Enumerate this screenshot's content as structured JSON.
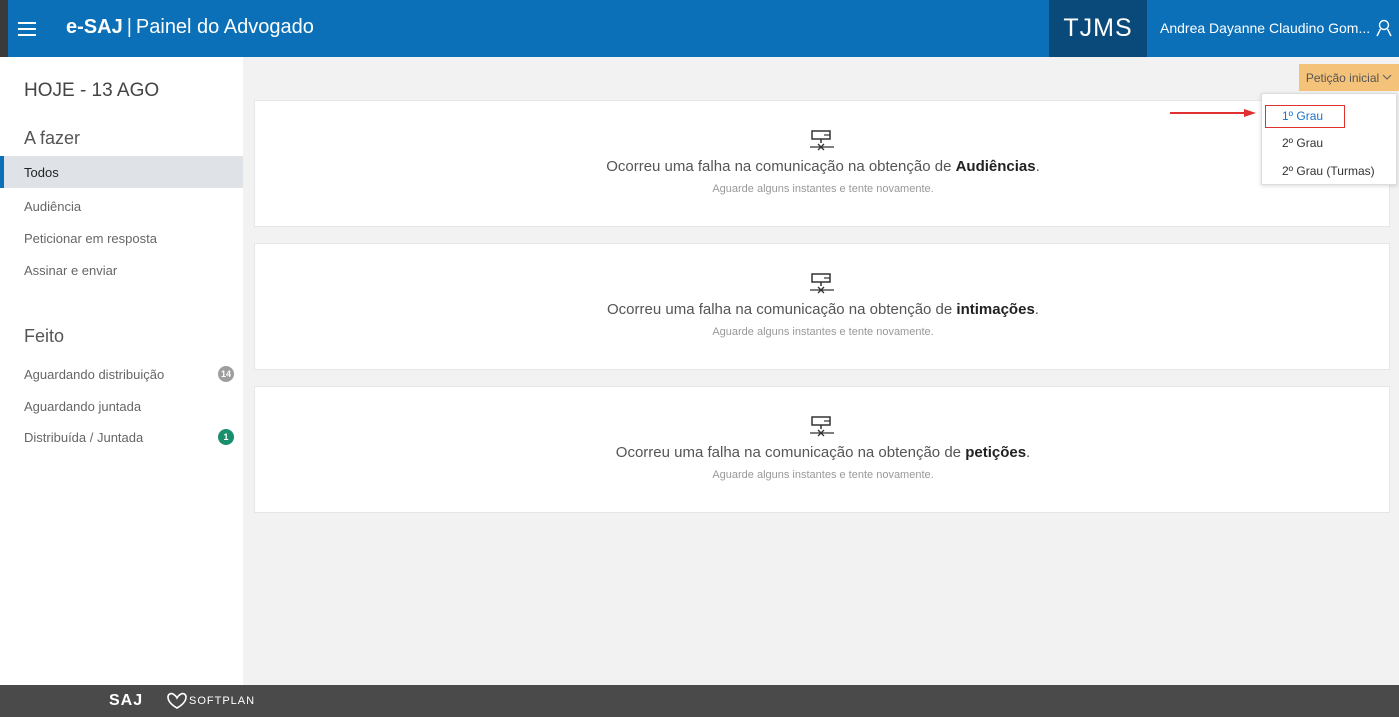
{
  "header": {
    "brand_bold": "e-SAJ",
    "brand_sep": "|",
    "brand_sub": "Painel do Advogado",
    "tribunal": "TJMS",
    "user_name": "Andrea Dayanne Claudino Gom..."
  },
  "sidebar": {
    "today": "HOJE - 13 AGO",
    "todo_title": "A fazer",
    "todo_items": [
      {
        "label": "Todos"
      },
      {
        "label": "Audiência"
      },
      {
        "label": "Peticionar em resposta"
      },
      {
        "label": "Assinar e enviar"
      }
    ],
    "done_title": "Feito",
    "done_items": [
      {
        "label": "Aguardando distribuição",
        "badge": "14"
      },
      {
        "label": "Aguardando juntada"
      },
      {
        "label": "Distribuída / Juntada",
        "badge": "1"
      }
    ]
  },
  "petition_button": {
    "label": "Petição inicial"
  },
  "dropdown": {
    "items": [
      "1º Grau",
      "2º Grau",
      "2º Grau (Turmas)"
    ]
  },
  "cards": [
    {
      "prefix": "Ocorreu uma falha na comunicação na obtenção de",
      "bold": "Audiências",
      "suffix": ".",
      "hint": "Aguarde alguns instantes e tente novamente."
    },
    {
      "prefix": "Ocorreu uma falha na comunicação na obtenção de",
      "bold": "intimações",
      "suffix": ".",
      "hint": "Aguarde alguns instantes e tente novamente."
    },
    {
      "prefix": "Ocorreu uma falha na comunicação na obtenção de",
      "bold": "petições",
      "suffix": ".",
      "hint": "Aguarde alguns instantes e tente novamente."
    }
  ],
  "footer": {
    "saj": "SAJ",
    "softplan": "SOFTPLAN"
  },
  "colors": {
    "header_blue": "#0b70b8",
    "tribunal_bg": "#0a4a7a",
    "petition_btn": "#f5c27a",
    "badge_gray": "#9e9e9e",
    "badge_green": "#1a8f6e",
    "highlight_red": "#e03030"
  }
}
